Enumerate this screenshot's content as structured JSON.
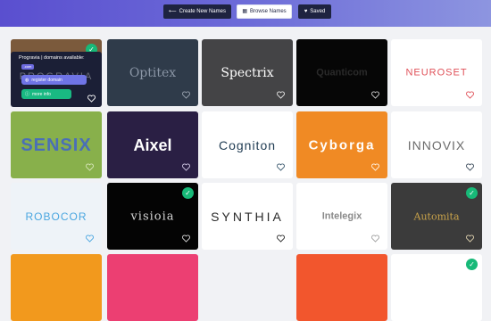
{
  "nav": {
    "create": "Create New Names",
    "browse": "Browse Names",
    "saved": "Saved"
  },
  "popup": {
    "header": "Progravia | domains available:",
    "tld": ".com",
    "register": "register domain",
    "more": "more info",
    "ghost": "PROGRAVIA"
  },
  "cards": [
    {
      "name": "Optitex"
    },
    {
      "name": "Spectrix"
    },
    {
      "name": "Quanticom"
    },
    {
      "name": "NEUROSET"
    },
    {
      "name": "SENSIX"
    },
    {
      "name": "Aixel"
    },
    {
      "name": "Cogniton"
    },
    {
      "name": "Cyborga"
    },
    {
      "name": "INNOVIX"
    },
    {
      "name": "ROBOCOR"
    },
    {
      "name": "visioia"
    },
    {
      "name": "SYNTHIA"
    },
    {
      "name": "Intelegix"
    },
    {
      "name": "Automita"
    }
  ],
  "colors": {
    "accent": "#17b978",
    "nav_dark": "#1e2340",
    "header_gradient_start": "#5a4fcf"
  }
}
